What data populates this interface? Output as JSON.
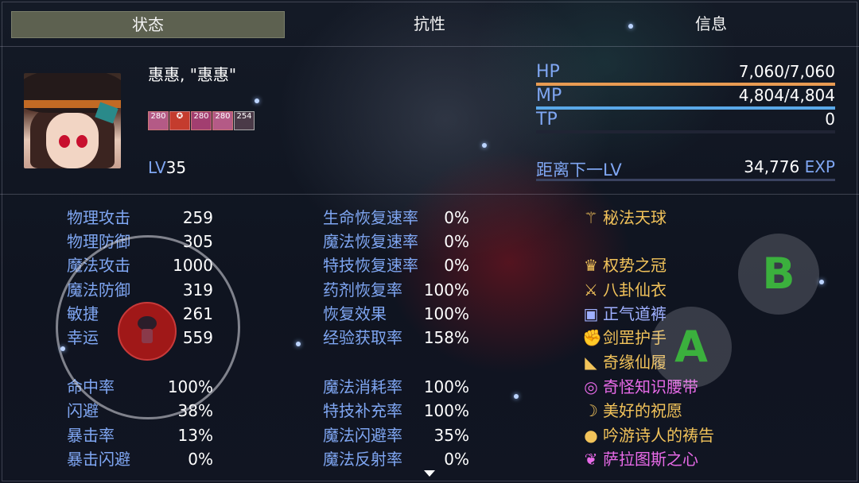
{
  "tabs": [
    {
      "label": "状态",
      "active": true
    },
    {
      "label": "抗性",
      "active": false
    },
    {
      "label": "信息",
      "active": false
    }
  ],
  "actor": {
    "name": "惠惠, \"惠惠\"",
    "level_label": "LV",
    "level": "35",
    "state_icons": [
      "280",
      "",
      "280",
      "280",
      "254"
    ]
  },
  "gauges": {
    "hp": {
      "label": "HP",
      "value": "7,060/7,060",
      "fill": 1.0,
      "color": "#e89b52"
    },
    "mp": {
      "label": "MP",
      "value": "4,804/4,804",
      "fill": 1.0,
      "color": "#5aa8e8"
    },
    "tp": {
      "label": "TP",
      "value": "0",
      "fill": 0.0,
      "color": "#7dd46a"
    }
  },
  "exp": {
    "label": "距离下一LV",
    "value": "34,776",
    "unit": "EXP"
  },
  "params": [
    {
      "label": "物理攻击",
      "value": "259"
    },
    {
      "label": "物理防御",
      "value": "305"
    },
    {
      "label": "魔法攻击",
      "value": "1000"
    },
    {
      "label": "魔法防御",
      "value": "319"
    },
    {
      "label": "敏捷",
      "value": "261"
    },
    {
      "label": "幸运",
      "value": "559"
    }
  ],
  "xparams": [
    {
      "label": "命中率",
      "value": "100%"
    },
    {
      "label": "闪避",
      "value": "38%"
    },
    {
      "label": "暴击率",
      "value": "13%"
    },
    {
      "label": "暴击闪避",
      "value": "0%"
    }
  ],
  "regen": [
    {
      "label": "生命恢复速率",
      "value": "0%"
    },
    {
      "label": "魔法恢复速率",
      "value": "0%"
    },
    {
      "label": "特技恢复速率",
      "value": "0%"
    },
    {
      "label": "药剂恢复率",
      "value": "100%"
    },
    {
      "label": "恢复效果",
      "value": "100%"
    },
    {
      "label": "经验获取率",
      "value": "158%"
    }
  ],
  "sparams": [
    {
      "label": "魔法消耗率",
      "value": "100%"
    },
    {
      "label": "特技补充率",
      "value": "100%"
    },
    {
      "label": "魔法闪避率",
      "value": "35%"
    },
    {
      "label": "魔法反射率",
      "value": "0%"
    }
  ],
  "equipment": [
    {
      "name": "秘法天球",
      "icon": "staff-icon",
      "glyph": "⚚",
      "color": "#f2c35a"
    },
    {
      "name": "",
      "icon": "",
      "glyph": "",
      "color": "#ffffff"
    },
    {
      "name": "权势之冠",
      "icon": "crown-icon",
      "glyph": "♛",
      "color": "#f2c35a"
    },
    {
      "name": "八卦仙衣",
      "icon": "robe-icon",
      "glyph": "⚔",
      "color": "#f2c35a"
    },
    {
      "name": "正气道裤",
      "icon": "pants-icon",
      "glyph": "▣",
      "color": "#9fb0ff"
    },
    {
      "name": "剑罡护手",
      "icon": "gauntlet-icon",
      "glyph": "✊",
      "color": "#f2c35a"
    },
    {
      "name": "奇缘仙履",
      "icon": "boots-icon",
      "glyph": "◣",
      "color": "#f2c35a"
    },
    {
      "name": "奇怪知识腰带",
      "icon": "belt-icon",
      "glyph": "◎",
      "color": "#e86ae8"
    },
    {
      "name": "美好的祝愿",
      "icon": "necklace-icon",
      "glyph": "☽",
      "color": "#f2c35a"
    },
    {
      "name": "吟游诗人的祷告",
      "icon": "ring-icon",
      "glyph": "●",
      "color": "#f2c35a"
    },
    {
      "name": "萨拉图斯之心",
      "icon": "heart-icon",
      "glyph": "❦",
      "color": "#e86ae8"
    }
  ],
  "touch": {
    "a_label": "A",
    "b_label": "B"
  }
}
